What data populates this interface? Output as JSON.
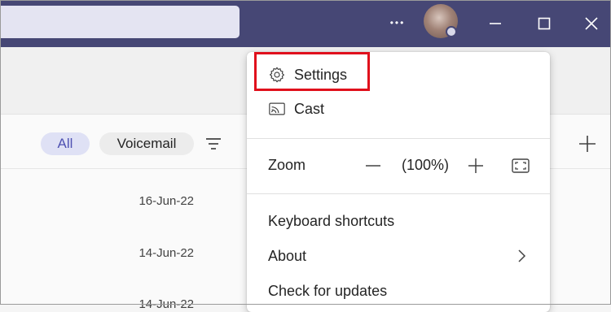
{
  "titlebar": {
    "more_label": "•••",
    "icons": [
      "more-icon",
      "avatar",
      "minimize-icon",
      "maximize-icon",
      "close-icon"
    ]
  },
  "filters": {
    "all_label": "All",
    "voicemail_label": "Voicemail"
  },
  "list": {
    "dates": [
      "16-Jun-22",
      "14-Jun-22",
      "14-Jun-22"
    ]
  },
  "menu": {
    "settings_label": "Settings",
    "cast_label": "Cast",
    "zoom": {
      "label": "Zoom",
      "value": "(100%)"
    },
    "keyboard_shortcuts_label": "Keyboard shortcuts",
    "about_label": "About",
    "check_updates_label": "Check for updates"
  },
  "colors": {
    "titlebar": "#464775",
    "search": "#e4e4f2",
    "pill_all_bg": "#dfe1f5",
    "pill_all_text": "#4f52b2",
    "highlight": "#e0101c"
  }
}
